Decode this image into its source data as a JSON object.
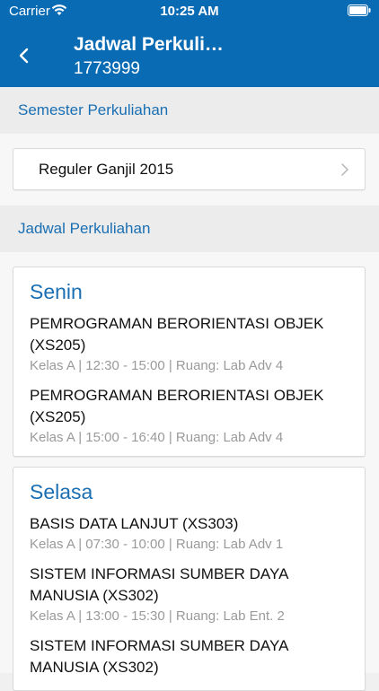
{
  "status_bar": {
    "carrier": "Carrier",
    "time": "10:25 AM"
  },
  "nav": {
    "title": "Jadwal Perkuli…",
    "subtitle": "1773999"
  },
  "sections": {
    "semester_header": "Semester Perkuliahan",
    "schedule_header": "Jadwal Perkuliahan"
  },
  "semester": {
    "selected": "Reguler Ganjil 2015"
  },
  "schedule": [
    {
      "day": "Senin",
      "courses": [
        {
          "name": "PEMROGRAMAN BERORIENTASI OBJEK (XS205)",
          "detail": "Kelas A | 12:30 - 15:00 | Ruang: Lab Adv 4"
        },
        {
          "name": "PEMROGRAMAN BERORIENTASI OBJEK (XS205)",
          "detail": "Kelas A | 15:00 - 16:40 | Ruang: Lab Adv 4"
        }
      ]
    },
    {
      "day": "Selasa",
      "courses": [
        {
          "name": "BASIS DATA LANJUT (XS303)",
          "detail": "Kelas A | 07:30 - 10:00 | Ruang: Lab Adv 1"
        },
        {
          "name": "SISTEM INFORMASI SUMBER DAYA MANUSIA (XS302)",
          "detail": "Kelas A | 13:00 - 15:30 | Ruang: Lab Ent. 2"
        },
        {
          "name": "SISTEM INFORMASI SUMBER DAYA MANUSIA (XS302)",
          "detail": ""
        }
      ]
    }
  ],
  "colors": {
    "header_bg": "#0a6bb5",
    "accent": "#1a6fb3",
    "detail_text": "#9a9a9a"
  }
}
